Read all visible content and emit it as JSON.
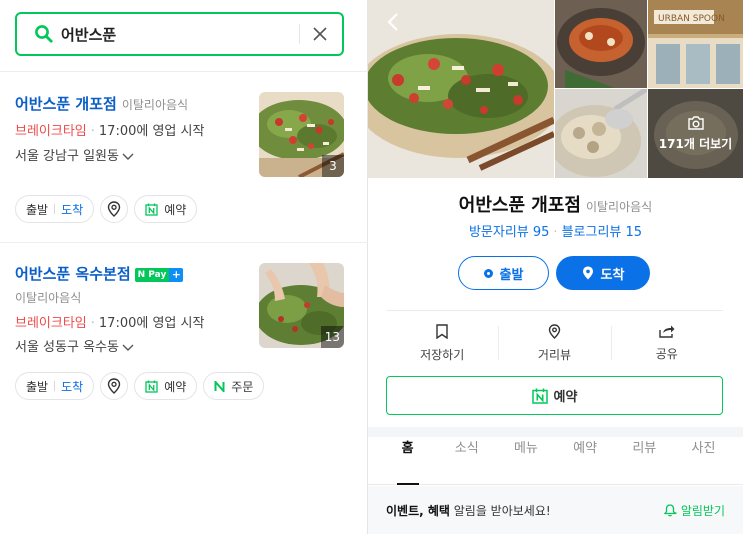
{
  "search": {
    "query": "어반스푼"
  },
  "results": [
    {
      "name": "어반스푼 개포점",
      "category": "이탈리아음식",
      "status": "브레이크타임",
      "hours": "17:00에 영업 시작",
      "address": "서울 강남구 일원동",
      "photo_count": "3",
      "chips": {
        "depart": "출발",
        "arrive": "도착",
        "reserve": "예약"
      }
    },
    {
      "name": "어반스푼 옥수본점",
      "npay_label": "N Pay",
      "npay_plus": "+",
      "category": "이탈리아음식",
      "status": "브레이크타임",
      "hours": "17:00에 영업 시작",
      "address": "서울 성동구 옥수동",
      "photo_count": "13",
      "chips": {
        "depart": "출발",
        "arrive": "도착",
        "reserve": "예약",
        "order": "주문"
      }
    }
  ],
  "detail": {
    "more_photos": "171개 더보기",
    "name": "어반스푼 개포점",
    "category": "이탈리아음식",
    "visitor_reviews": "방문자리뷰 95",
    "blog_reviews": "블로그리뷰 15",
    "depart_label": "출발",
    "arrive_label": "도착",
    "actions": {
      "save": "저장하기",
      "distance": "거리뷰",
      "share": "공유"
    },
    "reserve_label": "예약",
    "tabs": [
      "홈",
      "소식",
      "메뉴",
      "예약",
      "리뷰",
      "사진"
    ],
    "active_tab": "홈",
    "alert": {
      "bold": "이벤트, 혜택",
      "text": " 알림을 받아보세요!",
      "subscribe": "알림받기"
    }
  },
  "colors": {
    "brand_green": "#03c75a",
    "link_blue": "#0a5fc7",
    "action_blue": "#0a71e6",
    "break_red": "#ef4a4a"
  }
}
